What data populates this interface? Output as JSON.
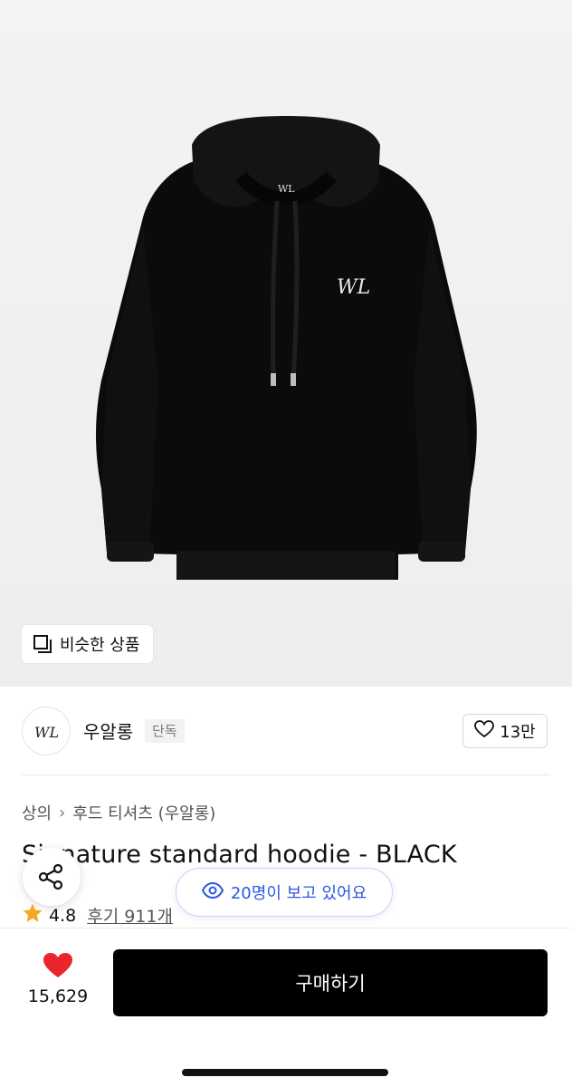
{
  "hero": {
    "image_icon": "black-hoodie-product-photo",
    "similar_button": {
      "icon": "similar-items-icon",
      "label": "비슷한 상품"
    }
  },
  "brand": {
    "logo_icon": "wl-brand-logo",
    "name": "우알롱",
    "badge": "단독",
    "like_count": "13만",
    "like_icon": "heart-outline-icon"
  },
  "product": {
    "breadcrumb": [
      "상의",
      "후드 티셔츠 (우알롱)"
    ],
    "title": "Signature standard hoodie - BLACK",
    "title_visible": "S      ature standard hoodie - BLACK",
    "viewers_text": "20명이 보고 있어요",
    "rating": "4.8",
    "reviews": "후기 911개"
  },
  "bottom": {
    "wish_count": "15,629",
    "buy_label": "구매하기"
  },
  "colors": {
    "accent_blue": "#2d58e6",
    "heart_red": "#e8262b",
    "star_orange": "#f5a623",
    "buy_button": "#000000"
  }
}
